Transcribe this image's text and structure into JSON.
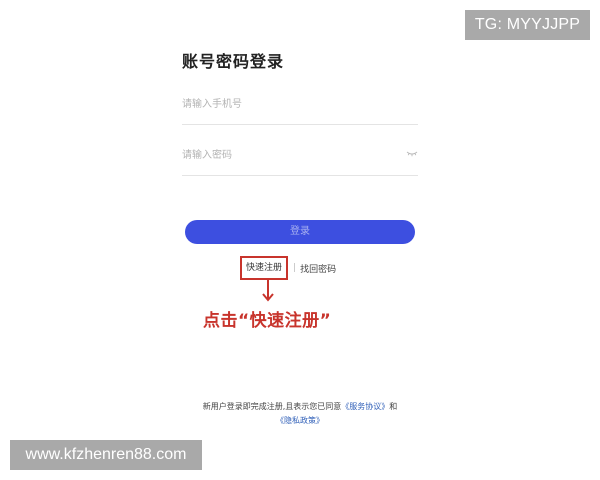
{
  "watermarks": {
    "telegram": "TG: MYYJJPP",
    "site": "www.kfzhenren88.com"
  },
  "login": {
    "title": "账号密码登录",
    "phone_placeholder": "请输入手机号",
    "password_placeholder": "请输入密码",
    "password_toggle_icon": "eye-closed-icon",
    "submit_label": "登录"
  },
  "links": {
    "quick_register": "快速注册",
    "separator": "|",
    "recover_password": "找回密码"
  },
  "annotation": {
    "text": "点击“快速注册”",
    "arrow_icon": "arrow-down-icon",
    "color": "#c8342c"
  },
  "agreement": {
    "prefix": "新用户登录即完成注册,且表示您已同意",
    "service_agreement": "《服务协议》",
    "conjunction": "和",
    "privacy_policy": "《隐私政策》"
  },
  "colors": {
    "primary": "#3d4fe0",
    "annotation": "#c8342c",
    "link": "#2f5fb8"
  }
}
